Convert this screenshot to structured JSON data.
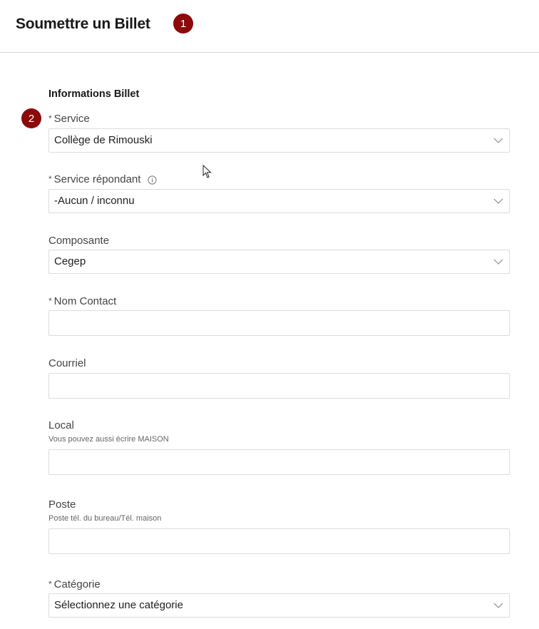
{
  "header": {
    "title": "Soumettre un Billet",
    "badge": "1"
  },
  "form": {
    "badge": "2",
    "section_title": "Informations Billet",
    "required_marker": "*",
    "fields": {
      "service": {
        "label": "Service",
        "value": "Collège de Rimouski"
      },
      "service_repondant": {
        "label": "Service répondant",
        "value": "-Aucun / inconnu",
        "icon": "info-icon"
      },
      "composante": {
        "label": "Composante",
        "value": "Cegep"
      },
      "nom_contact": {
        "label": "Nom Contact",
        "value": ""
      },
      "courriel": {
        "label": "Courriel",
        "value": ""
      },
      "local": {
        "label": "Local",
        "help": "Vous pouvez aussi écrire MAISON",
        "value": ""
      },
      "poste": {
        "label": "Poste",
        "help": "Poste tél. du bureau/Tél. maison",
        "value": ""
      },
      "categorie": {
        "label": "Catégorie",
        "value": "Sélectionnez une catégorie"
      }
    }
  },
  "colors": {
    "accent": "#8b0a0a",
    "border": "#dcdcdc"
  }
}
